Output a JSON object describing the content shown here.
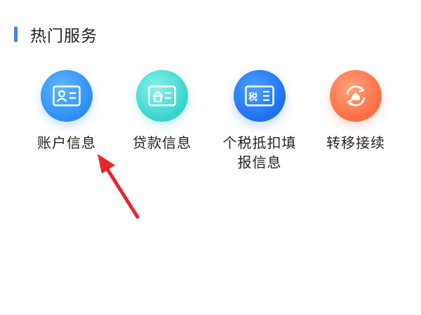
{
  "section": {
    "title": "热门服务",
    "accent_color": "#4a7df0"
  },
  "services": [
    {
      "label": "账户信息",
      "icon": "id-card-icon",
      "color": "#2d8df5"
    },
    {
      "label": "贷款信息",
      "icon": "house-card-icon",
      "color": "#35d3cc"
    },
    {
      "label": "个税抵扣填报信息",
      "icon": "tax-card-icon",
      "icon_text": "税",
      "color": "#1e6ff0"
    },
    {
      "label": "转移接续",
      "icon": "transfer-house-icon",
      "color": "#ff6e45"
    }
  ],
  "annotation": {
    "arrow_color": "#e8262a"
  }
}
